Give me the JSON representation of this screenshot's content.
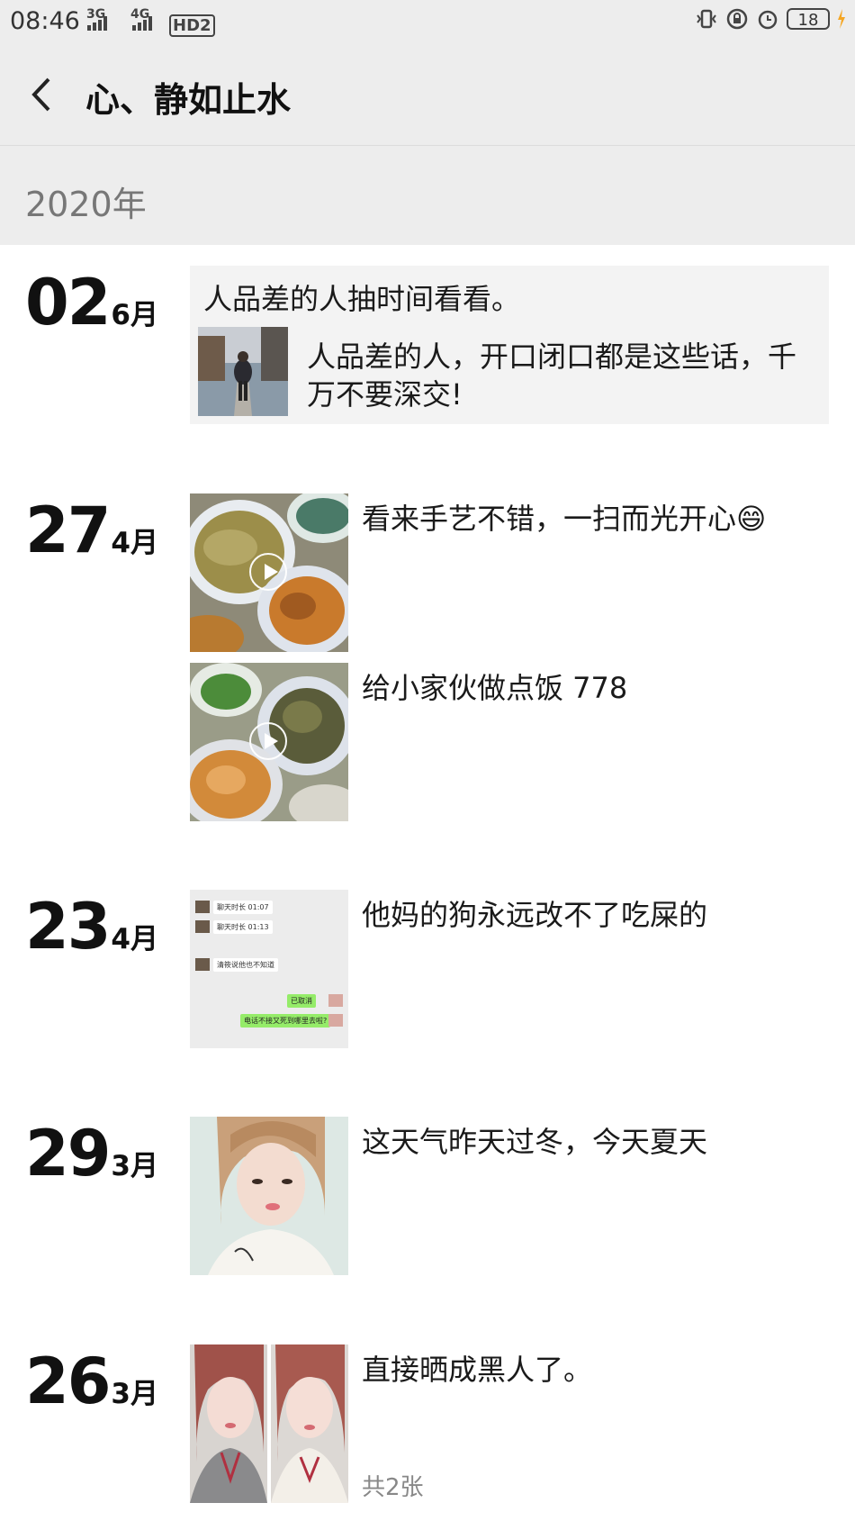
{
  "status": {
    "time": "08:46",
    "net1": "3G",
    "net2": "4G",
    "hd": "HD2",
    "battery": "18"
  },
  "header": {
    "title": "心、静如止水"
  },
  "year": "2020年",
  "entries": [
    {
      "day": "02",
      "month": "6月",
      "share_title": "人品差的人抽时间看看。",
      "share_desc": "人品差的人，开口闭口都是这些话，千万不要深交!"
    },
    {
      "day": "27",
      "month": "4月",
      "text": "看来手艺不错，一扫而光开心😄"
    },
    {
      "text": "给小家伙做点饭 778"
    },
    {
      "day": "23",
      "month": "4月",
      "text": "他妈的狗永远改不了吃屎的",
      "chat": [
        "聊天时长 01:07",
        "聊天时长 01:13",
        "清筱说他也不知道",
        "已取消",
        "电话不接又死到哪里去啦?"
      ]
    },
    {
      "day": "29",
      "month": "3月",
      "text": "这天气昨天过冬，今天夏天"
    },
    {
      "day": "26",
      "month": "3月",
      "text": "直接晒成黑人了。",
      "count": "共2张"
    }
  ],
  "colors": {
    "header_bg": "#ededed",
    "share_bg": "#f3f3f3",
    "chat_green": "#95ec69"
  }
}
